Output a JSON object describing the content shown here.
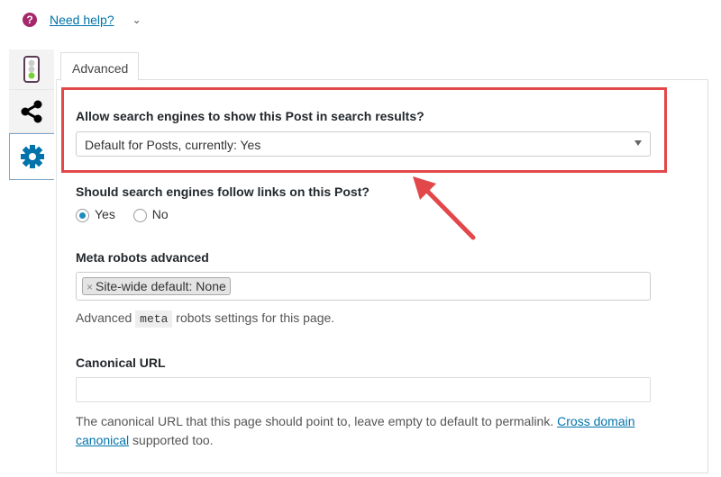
{
  "help": {
    "icon": "question-circle-icon",
    "link": "Need help?"
  },
  "sidebar": {
    "items": [
      {
        "icon": "traffic-light-icon"
      },
      {
        "icon": "share-icon"
      },
      {
        "icon": "gear-icon",
        "active": true
      }
    ]
  },
  "tabs": [
    {
      "label": "Advanced",
      "active": true
    }
  ],
  "index": {
    "label": "Allow search engines to show this Post in search results?",
    "value": "Default for Posts, currently: Yes"
  },
  "follow": {
    "label": "Should search engines follow links on this Post?",
    "options": [
      {
        "label": "Yes",
        "checked": true
      },
      {
        "label": "No",
        "checked": false
      }
    ]
  },
  "meta_robots": {
    "label": "Meta robots advanced",
    "chip": "Site-wide default: None",
    "chip_remove": "×",
    "desc_pre": "Advanced",
    "desc_code": "meta",
    "desc_post": "robots settings for this page."
  },
  "canonical": {
    "label": "Canonical URL",
    "value": "",
    "desc": "The canonical URL that this page should point to, leave empty to default to permalink.",
    "link1": "Cross domain",
    "link2": "canonical",
    "desc_end": "supported too."
  },
  "colors": {
    "highlight": "#e2474a",
    "accent": "#0073aa"
  }
}
